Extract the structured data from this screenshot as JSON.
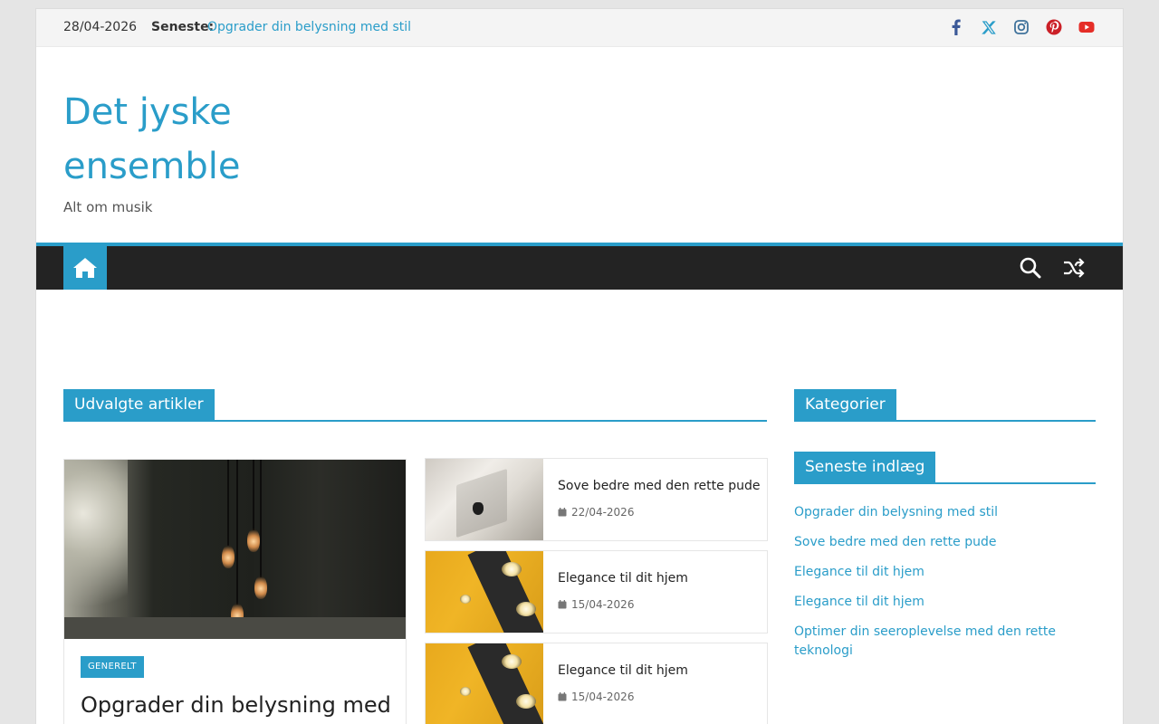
{
  "topbar": {
    "date": "28/04-2026",
    "latest_label": "Seneste:",
    "latest_link": "Opgrader din belysning med stil",
    "social": [
      "facebook-icon",
      "x-icon",
      "instagram-icon",
      "pinterest-icon",
      "youtube-icon"
    ]
  },
  "header": {
    "site_title": "Det jyske ensemble",
    "tagline": "Alt om musik"
  },
  "colors": {
    "accent": "#2a9dc9",
    "nav_bg": "#232323",
    "facebook": "#3b5998",
    "x": "#2a9dc9",
    "instagram": "#3f729b",
    "pinterest": "#cb2027",
    "youtube": "#e52d27"
  },
  "featured": {
    "heading": "Udvalgte artikler",
    "big": {
      "category": "GENERELT",
      "title": "Opgrader din belysning med"
    },
    "cards": [
      {
        "title": "Sove bedre med den rette pude",
        "date": "22/04-2026"
      },
      {
        "title": "Elegance til dit hjem",
        "date": "15/04-2026"
      },
      {
        "title": "Elegance til dit hjem",
        "date": "15/04-2026"
      }
    ]
  },
  "sidebar": {
    "categories_heading": "Kategorier",
    "recent_heading": "Seneste indlæg",
    "recent": [
      "Opgrader din belysning med stil",
      "Sove bedre med den rette pude",
      "Elegance til dit hjem",
      "Elegance til dit hjem",
      "Optimer din seeroplevelse med den rette teknologi"
    ]
  }
}
